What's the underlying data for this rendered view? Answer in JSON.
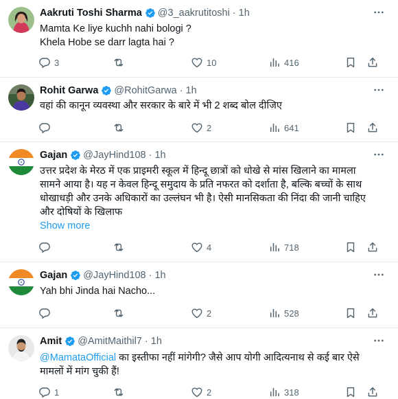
{
  "tweets": [
    {
      "name": "Aakruti Toshi Sharma",
      "handle": "@3_aakrutitoshi",
      "time": "1h",
      "lines": [
        "Mamta Ke liye kuchh nahi bologi ?",
        "Khela Hobe se darr lagta hai ?"
      ],
      "replies": "3",
      "retweets": "",
      "likes": "10",
      "views": "416",
      "avatar": "person-avatar"
    },
    {
      "name": "Rohit Garwa",
      "handle": "@RohitGarwa",
      "time": "1h",
      "lines": [
        "वहां की कानून व्यवस्था और सरकार के बारे में भी 2 शब्द बोल दीजिए"
      ],
      "replies": "",
      "retweets": "",
      "likes": "2",
      "views": "641",
      "avatar": "person-avatar"
    },
    {
      "name": "Gajan",
      "handle": "@JayHind108",
      "time": "1h",
      "lines": [
        "उत्तर प्रदेश के मेरठ में एक प्राइमरी स्कूल में हिन्दू छात्रों को धोखे से मांस खिलाने का मामला",
        "सामने आया है। यह न केवल हिन्दू समुदाय के प्रति नफरत को दर्शाता है, बल्कि बच्चों के साथ",
        "धोखाधड़ी और उनके अधिकारों का उल्लंघन भी है। ऐसी मानसिकता की निंदा की जानी चाहिए",
        "और दोषियों के खिलाफ"
      ],
      "show_more": "Show more",
      "replies": "",
      "retweets": "",
      "likes": "4",
      "views": "718",
      "avatar": "india-flag-avatar"
    },
    {
      "name": "Gajan",
      "handle": "@JayHind108",
      "time": "1h",
      "lines": [
        "Yah bhi Jinda hai Nacho..."
      ],
      "replies": "",
      "retweets": "",
      "likes": "2",
      "views": "528",
      "avatar": "india-flag-avatar"
    },
    {
      "name": "Amit",
      "handle": "@AmitMaithil7",
      "time": "1h",
      "mention": "@MamataOfficial",
      "lines": [
        " का इस्तीफा नहीं मांगेगी? जैसे आप योगी आदित्यनाथ से कई बार ऐसे",
        "मामलों में मांग चुकी हैं!"
      ],
      "replies": "1",
      "retweets": "",
      "likes": "2",
      "views": "318",
      "avatar": "person-avatar"
    }
  ],
  "colors": {
    "text": "#0f1419",
    "secondary": "#536471",
    "link": "#1d9bf0",
    "verified": "#1d9bf0",
    "divider": "#e6ebef"
  },
  "icons": [
    "verified-badge-icon",
    "more-icon",
    "reply-icon",
    "retweet-icon",
    "like-icon",
    "views-icon",
    "bookmark-icon",
    "share-icon"
  ]
}
